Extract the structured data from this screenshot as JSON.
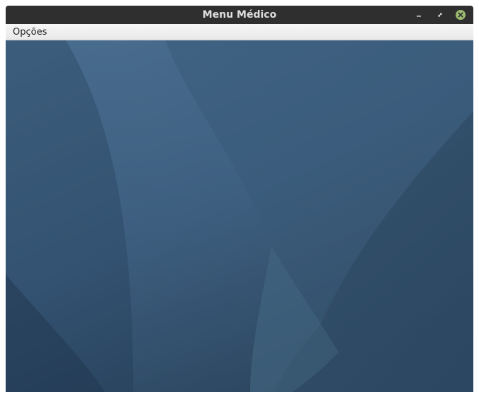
{
  "window": {
    "title": "Menu Médico"
  },
  "titlebar": {
    "buttons": [
      {
        "name": "minimize",
        "icon": "minimize-icon"
      },
      {
        "name": "maximize",
        "icon": "maximize-icon"
      },
      {
        "name": "close",
        "icon": "close-icon"
      }
    ]
  },
  "menubar": {
    "items": [
      {
        "label": "Opções"
      }
    ]
  },
  "colors": {
    "titlebar": "#2f2f2f",
    "title_text": "#dedede",
    "close_button": "#9bbb6f",
    "menubar": "#efefef",
    "content_background": "#3c5a75"
  }
}
